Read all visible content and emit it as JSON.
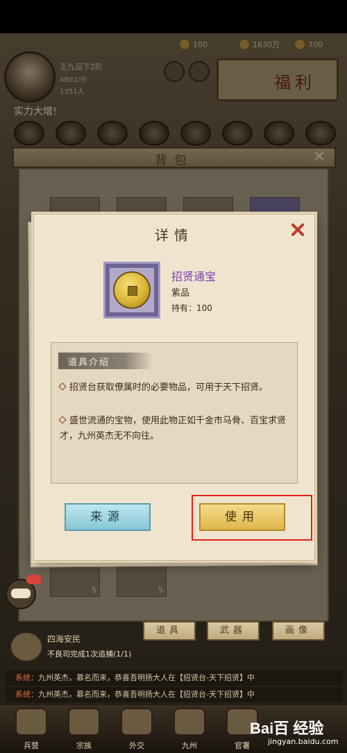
{
  "hud": {
    "resource_1": "100",
    "resource_2": "1630万",
    "resource_3": "700",
    "rank": "正九品下2阶",
    "power": "4802/分",
    "people": "1351人",
    "toast": "实力大增!",
    "welfare": "福利"
  },
  "bag": {
    "title": "背包",
    "slot_counts": [
      "5",
      "5"
    ],
    "tabs": [
      "道具",
      "武器",
      "画像"
    ]
  },
  "modal": {
    "title": "详情",
    "item": {
      "name": "招贤通宝",
      "grade": "紫品",
      "owned": "持有：100",
      "name_color": "#7b3fb0",
      "frame_color": "#6d6394"
    },
    "desc_header": "道具介绍",
    "desc_lines": [
      "招贤台获取僚属时的必要物品，可用于天下招贤。",
      "盛世流通的宝物，使用此物正如千金市马骨、百宝求贤才，九州英杰无不向往。"
    ],
    "buttons": {
      "source": "来源",
      "use": "使用"
    },
    "highlight_color": "#e0231a"
  },
  "quest": {
    "title": "四海安民",
    "desc": "不良司完成1次追捕(1/1)"
  },
  "system_messages": [
    {
      "prefix": "系统：",
      "text": "九州英杰，慕名而来，恭喜吾明扬大人在【招贤台-天下招贤】中"
    },
    {
      "prefix": "系统：",
      "text": "九州英杰，慕名而来，恭喜吾明扬大人在【招贤台-天下招贤】中"
    }
  ],
  "nav": [
    "兵营",
    "宗族",
    "外交",
    "九州",
    "官署"
  ],
  "watermark": {
    "logo": "Bai百 经验",
    "site": "jingyan.baidu.com"
  }
}
